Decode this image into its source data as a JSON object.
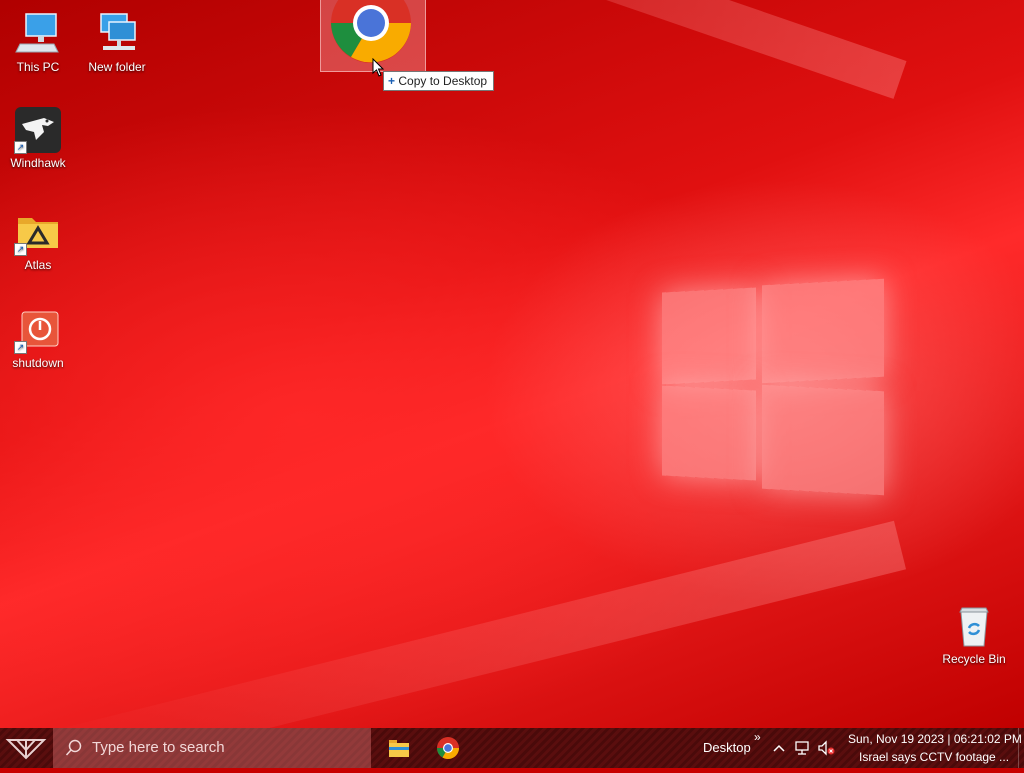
{
  "desktop": {
    "icons": [
      {
        "label": "This PC",
        "icon": "this-pc-icon"
      },
      {
        "label": "New folder",
        "icon": "network-folder-icon"
      },
      {
        "label": "Windhawk",
        "icon": "windhawk-eagle-icon"
      },
      {
        "label": "Atlas",
        "icon": "atlas-folder-icon"
      },
      {
        "label": "shutdown",
        "icon": "power-icon"
      },
      {
        "label": "Recycle Bin",
        "icon": "recycle-bin-icon"
      }
    ],
    "drag": {
      "item_icon": "chrome-icon",
      "tooltip_symbol": "+",
      "tooltip_label": "Copy to Desktop"
    }
  },
  "taskbar": {
    "search_placeholder": "Type here to search",
    "pinned": [
      {
        "icon": "file-explorer-icon"
      },
      {
        "icon": "chrome-icon"
      }
    ],
    "toolbar_label": "Desktop",
    "toolbar_more": "»",
    "tray_icons": [
      "chevron-up-icon",
      "network-icon",
      "volume-muted-icon"
    ],
    "clock_text": "Sun, Nov 19 2023 | 06:21:02 PM",
    "news_text": "Israel says CCTV footage ..."
  },
  "colors": {
    "wallpaper_accent": "#e01010",
    "taskbar": "#5a0e0e"
  }
}
